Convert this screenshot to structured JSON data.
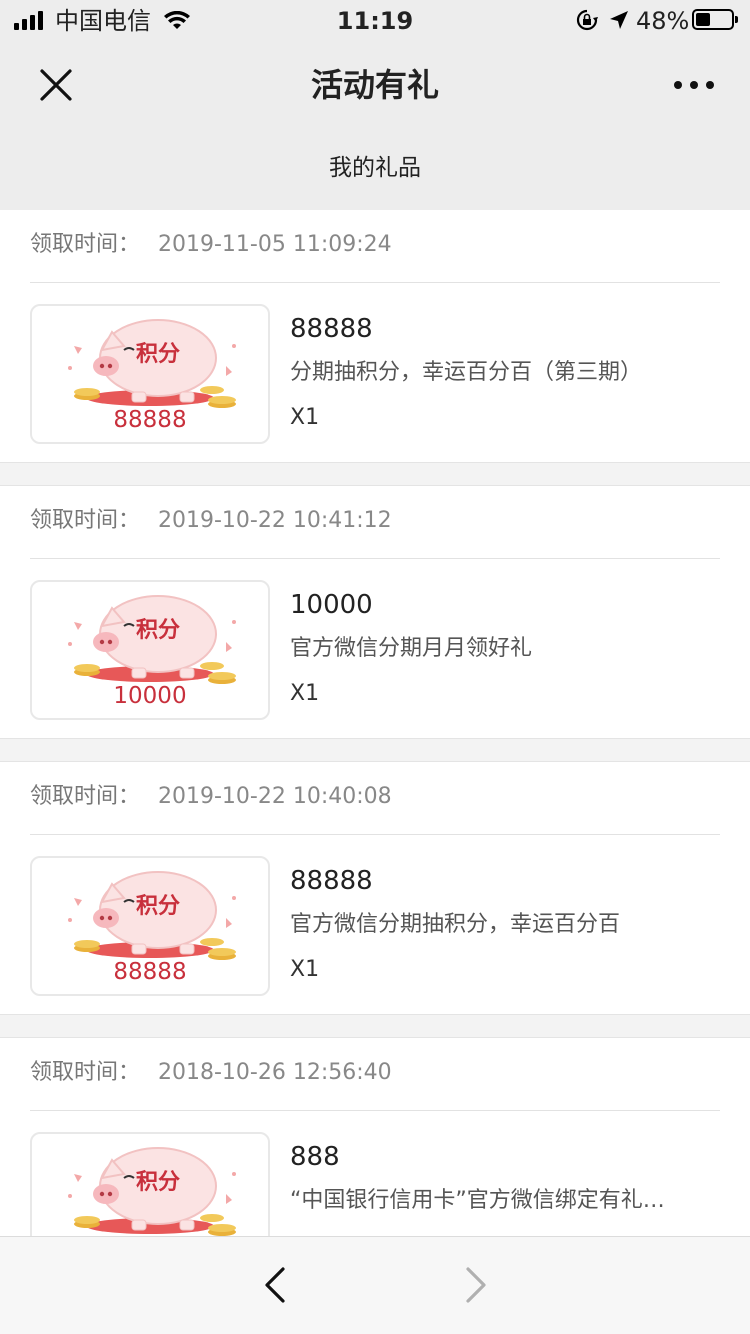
{
  "status_bar": {
    "carrier": "中国电信",
    "time": "11:19",
    "battery_percent": "48%",
    "battery_level": 0.48,
    "icons": [
      "signal-icon",
      "wifi-icon",
      "orientation-lock-icon",
      "location-arrow-icon",
      "battery-icon"
    ]
  },
  "nav": {
    "title": "活动有礼",
    "close_icon": "close-icon",
    "more_icon": "more-icon"
  },
  "sub_header": {
    "title": "我的礼品"
  },
  "gifts": [
    {
      "time_label": "领取时间：",
      "time": "2019-11-05 11:09:24",
      "thumb_label": "积分",
      "thumb_amount": "88888",
      "amount": "88888",
      "desc": "分期抽积分，幸运百分百（第三期）",
      "qty": "X1"
    },
    {
      "time_label": "领取时间：",
      "time": "2019-10-22 10:41:12",
      "thumb_label": "积分",
      "thumb_amount": "10000",
      "amount": "10000",
      "desc": "官方微信分期月月领好礼",
      "qty": "X1"
    },
    {
      "time_label": "领取时间：",
      "time": "2019-10-22 10:40:08",
      "thumb_label": "积分",
      "thumb_amount": "88888",
      "amount": "88888",
      "desc": "官方微信分期抽积分，幸运百分百",
      "qty": "X1"
    },
    {
      "time_label": "领取时间：",
      "time": "2018-10-26 12:56:40",
      "thumb_label": "积分",
      "thumb_amount": "",
      "amount": "888",
      "desc": "“中国银行信用卡”官方微信绑定有礼…",
      "qty": ""
    }
  ],
  "bottom_bar": {
    "back_icon": "chevron-left-icon",
    "forward_icon": "chevron-right-icon"
  },
  "colors": {
    "accent_red": "#c8303c",
    "background": "#ededed"
  }
}
